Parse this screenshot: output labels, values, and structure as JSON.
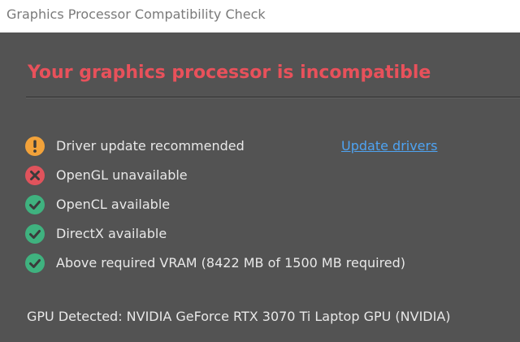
{
  "window": {
    "title": "Graphics Processor Compatibility Check"
  },
  "dialog": {
    "heading": "Your graphics processor is incompatible",
    "checks": [
      {
        "status": "warning",
        "icon": "warning-icon",
        "label": "Driver update recommended",
        "link": "Update drivers"
      },
      {
        "status": "error",
        "icon": "error-icon",
        "label": "OpenGL unavailable"
      },
      {
        "status": "ok",
        "icon": "check-icon",
        "label": "OpenCL available"
      },
      {
        "status": "ok",
        "icon": "check-icon",
        "label": "DirectX available"
      },
      {
        "status": "ok",
        "icon": "check-icon",
        "label": "Above required VRAM (8422 MB of 1500 MB required)"
      }
    ],
    "gpu_detected": "GPU Detected: NVIDIA GeForce RTX 3070 Ti Laptop GPU (NVIDIA)"
  },
  "colors": {
    "background": "#535353",
    "heading": "#e8515b",
    "warning": "#f2a23a",
    "error": "#e0535c",
    "ok": "#3fb27f",
    "link": "#4ea3f2"
  }
}
